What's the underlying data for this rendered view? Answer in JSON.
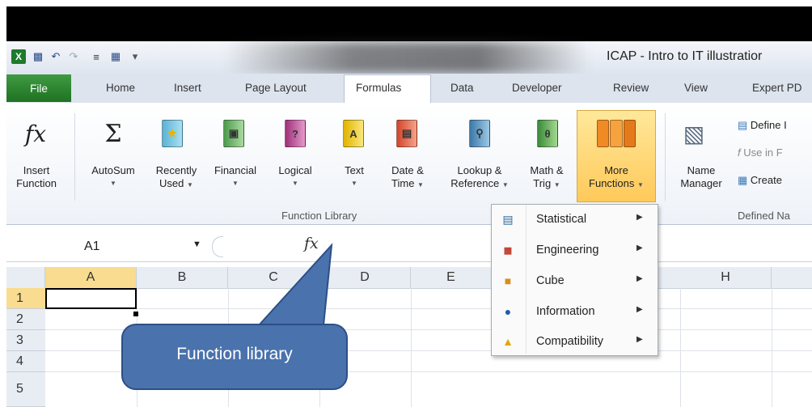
{
  "window": {
    "title": "ICAP - Intro to IT illustratior"
  },
  "quick_access": {
    "icons": [
      "excel-logo-icon",
      "save-icon",
      "undo-icon",
      "redo-icon",
      "align-icon",
      "print-preview-icon",
      "customize-icon"
    ]
  },
  "tabs": [
    {
      "label": "File"
    },
    {
      "label": "Home"
    },
    {
      "label": "Insert"
    },
    {
      "label": "Page Layout"
    },
    {
      "label": "Formulas"
    },
    {
      "label": "Data"
    },
    {
      "label": "Developer"
    },
    {
      "label": "Review"
    },
    {
      "label": "View"
    },
    {
      "label": "Expert PD"
    }
  ],
  "ribbon": {
    "insert_function": {
      "line1": "Insert",
      "line2": "Function",
      "icon_text": "fx"
    },
    "autosum": {
      "line1": "AutoSum",
      "icon_text": "Σ"
    },
    "recently_used": {
      "line1": "Recently",
      "line2": "Used"
    },
    "financial": {
      "line1": "Financial"
    },
    "logical": {
      "line1": "Logical",
      "icon_text": "?"
    },
    "text": {
      "line1": "Text",
      "icon_text": "A"
    },
    "datetime": {
      "line1": "Date &",
      "line2": "Time"
    },
    "lookup": {
      "line1": "Lookup &",
      "line2": "Reference"
    },
    "mathtrig": {
      "line1": "Math &",
      "line2": "Trig",
      "icon_text": "θ"
    },
    "more": {
      "line1": "More",
      "line2": "Functions"
    },
    "name_manager": {
      "line1": "Name",
      "line2": "Manager"
    },
    "define_name": "Define I",
    "use_in_formula": "Use in F",
    "create": "Create",
    "group_label": "Function Library",
    "defined_label": "Defined Na"
  },
  "formula_bar": {
    "name_box": "A1",
    "fx": "fx"
  },
  "grid": {
    "columns": [
      "A",
      "B",
      "C",
      "D",
      "E",
      "H"
    ],
    "rows": [
      "1",
      "2",
      "3",
      "4",
      "5"
    ]
  },
  "menu": {
    "items": [
      {
        "label": "Statistical",
        "icon": "statistical-icon"
      },
      {
        "label": "Engineering",
        "icon": "engineering-icon"
      },
      {
        "label": "Cube",
        "icon": "cube-icon"
      },
      {
        "label": "Information",
        "icon": "information-icon"
      },
      {
        "label": "Compatibility",
        "icon": "compatibility-icon"
      }
    ]
  },
  "callout": {
    "text": "Function library"
  },
  "colors": {
    "file_tab": "#2e8a31",
    "highlight": "#ffcf63",
    "callout": "#4a72ad"
  }
}
